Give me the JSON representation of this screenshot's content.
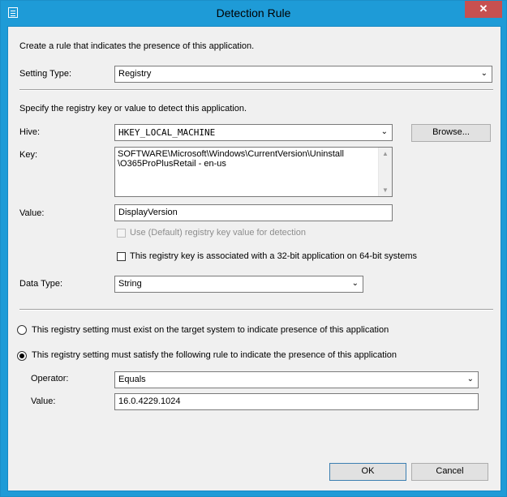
{
  "window": {
    "title": "Detection Rule",
    "close_glyph": "✕"
  },
  "intro": "Create a rule that indicates the presence of this application.",
  "setting_type": {
    "label": "Setting Type:",
    "value": "Registry"
  },
  "registry_intro": "Specify the registry key or value to detect this application.",
  "hive": {
    "label": "Hive:",
    "value": "HKEY_LOCAL_MACHINE",
    "browse_label": "Browse..."
  },
  "key": {
    "label": "Key:",
    "line1": "SOFTWARE\\Microsoft\\Windows\\CurrentVersion\\Uninstall",
    "line2": "\\O365ProPlusRetail - en-us"
  },
  "value": {
    "label": "Value:",
    "value": "DisplayVersion"
  },
  "use_default": {
    "label": "Use (Default) registry key value for detection",
    "checked": false,
    "enabled": false
  },
  "is32bit": {
    "label": "This registry key is associated with a 32-bit application on 64-bit systems",
    "checked": false
  },
  "data_type": {
    "label": "Data Type:",
    "value": "String"
  },
  "radio_exist": {
    "label": "This registry setting must exist on the target system to indicate presence of this application",
    "selected": false
  },
  "radio_rule": {
    "label": "This registry setting must satisfy the following rule to indicate the presence of this application",
    "selected": true
  },
  "operator": {
    "label": "Operator:",
    "value": "Equals"
  },
  "rule_value": {
    "label": "Value:",
    "value": "16.0.4229.1024"
  },
  "buttons": {
    "ok": "OK",
    "cancel": "Cancel"
  },
  "icons": {
    "system": "dialog-icon",
    "dropdown": "chevron-down-icon",
    "close": "close-icon"
  }
}
